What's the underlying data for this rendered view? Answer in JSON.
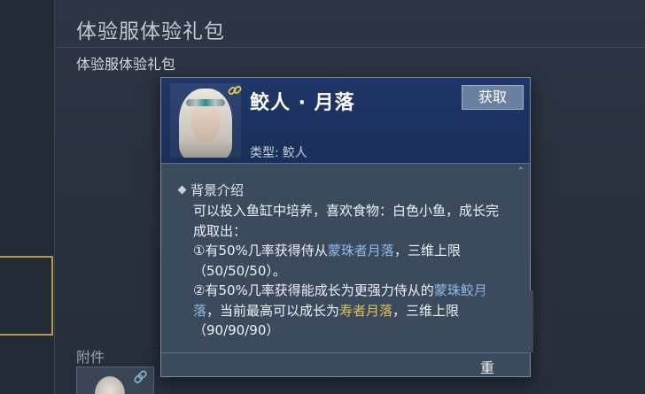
{
  "page": {
    "title": "体验服体验礼包",
    "mail_subject": "体验服体验礼包",
    "attachments_label": "附件"
  },
  "tooltip": {
    "name": "鲛人 · 月落",
    "get_button": "获取",
    "type_label": "类型:",
    "type_value": "鲛人",
    "section_title": "背景介绍",
    "desc": {
      "line1": "可以投入鱼缸中培养，喜欢食物：白色小鱼，成长完成取出：",
      "p1_pre": "①有50%几率获得侍从",
      "p1_hl": "蒙珠者月落",
      "p1_post": "，三维上限（50/50/50）。",
      "p2_pre": "②有50%几率获得能成长为更强力侍从的",
      "p2_hl": "蒙珠鲛月落",
      "p2_mid": "，当前最高可以成长为",
      "p2_hl2": "寿者月落",
      "p2_post": "，三维上限（90/90/90）"
    },
    "footer_text": "重"
  },
  "icons": {
    "link": "chain-link-icon",
    "portrait": "character-portrait",
    "diamond": "diamond-bullet-icon",
    "scroll": "scroll-up-icon"
  },
  "colors": {
    "header_bg": "#1e3668",
    "panel_bg": "#3c4a5e",
    "highlight_blue": "#8fbbe8",
    "highlight_gold": "#e2c056",
    "frame_gold": "#b89b45"
  }
}
